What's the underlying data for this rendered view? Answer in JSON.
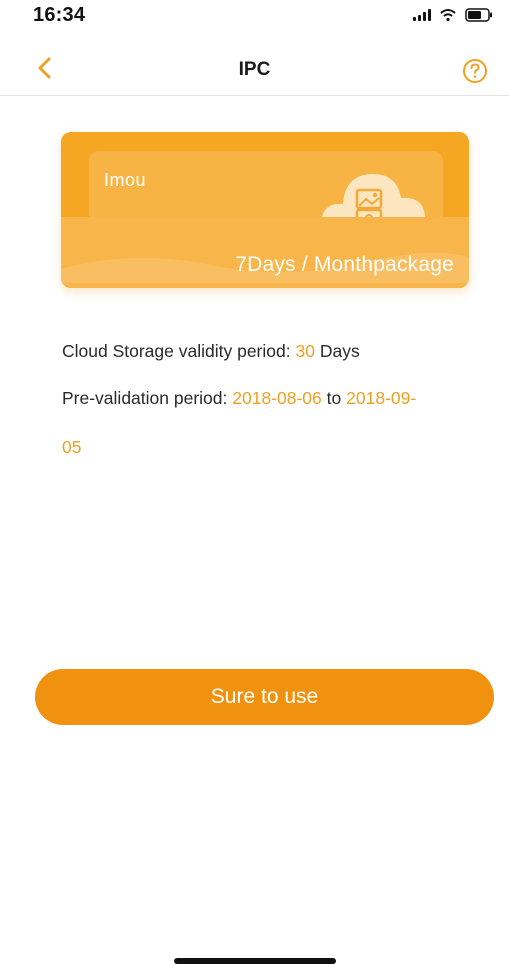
{
  "status_bar": {
    "time": "16:34",
    "icons": [
      "signal-icon",
      "wifi-icon",
      "battery-icon"
    ]
  },
  "nav": {
    "title": "IPC",
    "back_icon": "chevron-left-icon",
    "help_icon": "question-circle-icon"
  },
  "card": {
    "brand": "Imou",
    "package_label": "7Days / Monthpackage",
    "icon": "cloud-storage-icon"
  },
  "info": {
    "validity_label": "Cloud Storage validity period:",
    "validity_value": "30",
    "validity_unit": "Days",
    "pre_label": "Pre-validation period:",
    "pre_start": "2018-08-06",
    "pre_to": "to",
    "pre_end_part1": "2018-09-",
    "pre_end_part2": "05"
  },
  "actions": {
    "sure_label": "Sure to use"
  },
  "colors": {
    "accent": "#f0920f",
    "accent_text": "#f0a020",
    "card": "#f5a623"
  }
}
